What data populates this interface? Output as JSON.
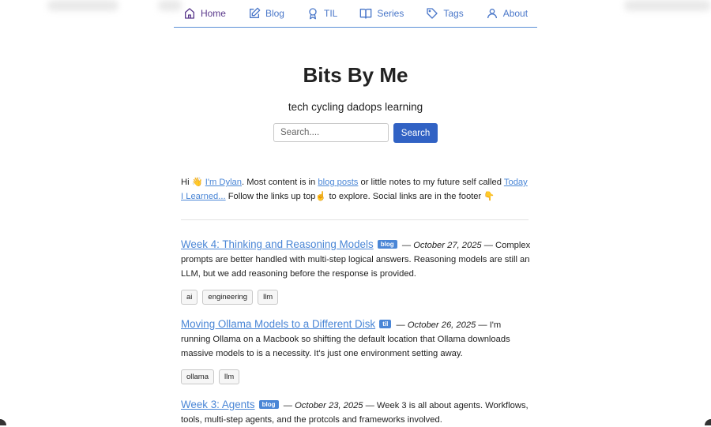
{
  "nav": {
    "items": [
      {
        "label": "Home",
        "icon": "home-icon"
      },
      {
        "label": "Blog",
        "icon": "edit-icon"
      },
      {
        "label": "TIL",
        "icon": "award-icon"
      },
      {
        "label": "Series",
        "icon": "book-open-icon"
      },
      {
        "label": "Tags",
        "icon": "tag-icon"
      },
      {
        "label": "About",
        "icon": "user-icon"
      }
    ],
    "active": "Home"
  },
  "site": {
    "title": "Bits By Me",
    "tagline": "tech cycling dadops learning"
  },
  "search": {
    "placeholder": "Search....",
    "button_label": "Search"
  },
  "intro": {
    "greeting": "Hi 👋 ",
    "me_link": "I'm Dylan",
    "text1": ". Most content is in ",
    "blog_link": "blog posts",
    "text2": " or little notes to my future self called ",
    "til_link": "Today I Learned...",
    "text3": " Follow the links up top☝️ to explore. Social links are in the footer 👇"
  },
  "posts": [
    {
      "title": "Week 4: Thinking and Reasoning Models",
      "badge": "blog",
      "date": "October 27, 2025",
      "summary": "Complex prompts are better handled with multi-step logical answers. Reasoning models are still an LLM, but we add reasoning before the response is provided.",
      "tags": [
        "ai",
        "engineering",
        "llm"
      ]
    },
    {
      "title": "Moving Ollama Models to a Different Disk",
      "badge": "til",
      "date": "October 26, 2025",
      "summary": "I'm running Ollama on a Macbook so shifting the default location that Ollama downloads massive models to is a necessity. It's just one environment setting away.",
      "tags": [
        "ollama",
        "llm"
      ]
    },
    {
      "title": "Week 3: Agents",
      "badge": "blog",
      "date": "October 23, 2025",
      "summary": "Week 3 is all about agents. Workflows, tools, multi-step agents, and the protcols and frameworks involved.",
      "tags": []
    }
  ],
  "colors": {
    "link": "#4a86d6",
    "primary_button": "#3162c4",
    "active_nav": "#5b3a8c"
  }
}
